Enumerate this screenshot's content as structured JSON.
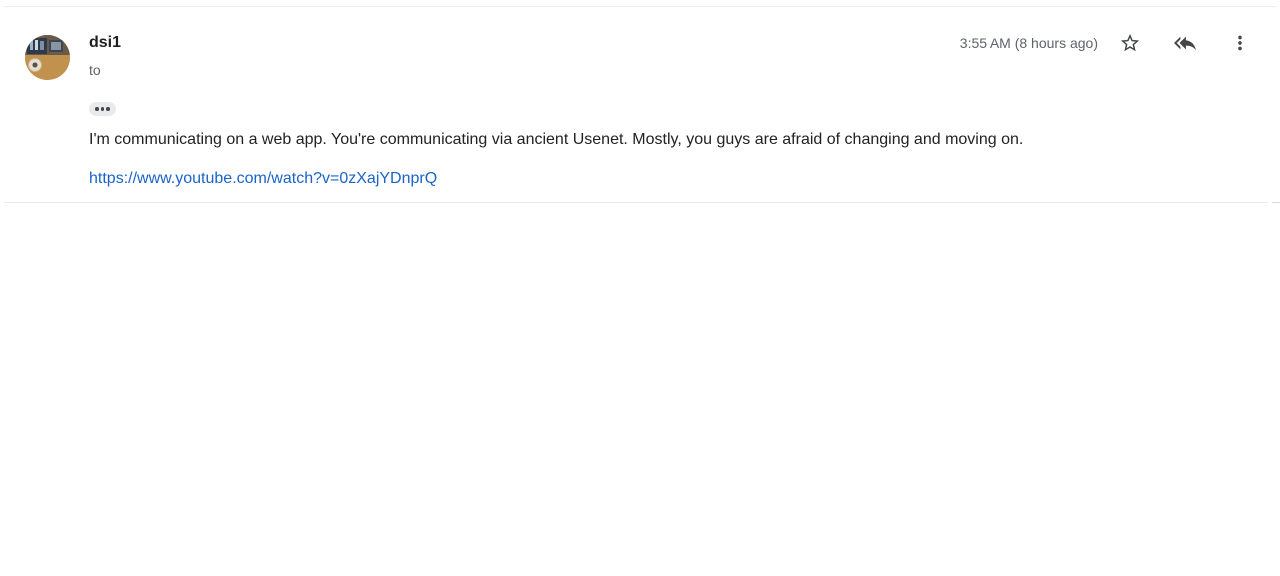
{
  "message": {
    "sender": "dsi1",
    "recipient_label": "to",
    "timestamp": "3:55 AM (8 hours ago)",
    "body": "I'm communicating on a web app. You're communicating via ancient Usenet. Mostly, you guys are afraid of changing and moving on.",
    "link": "https://www.youtube.com/watch?v=0zXajYDnprQ"
  },
  "icons": {
    "star": "star-icon",
    "reply_all": "reply-all-icon",
    "more": "more-vertical-icon",
    "expand": "ellipsis-icon"
  },
  "colors": {
    "link": "#1a64c8",
    "secondary_text": "#5f6368",
    "icon": "#444746"
  }
}
